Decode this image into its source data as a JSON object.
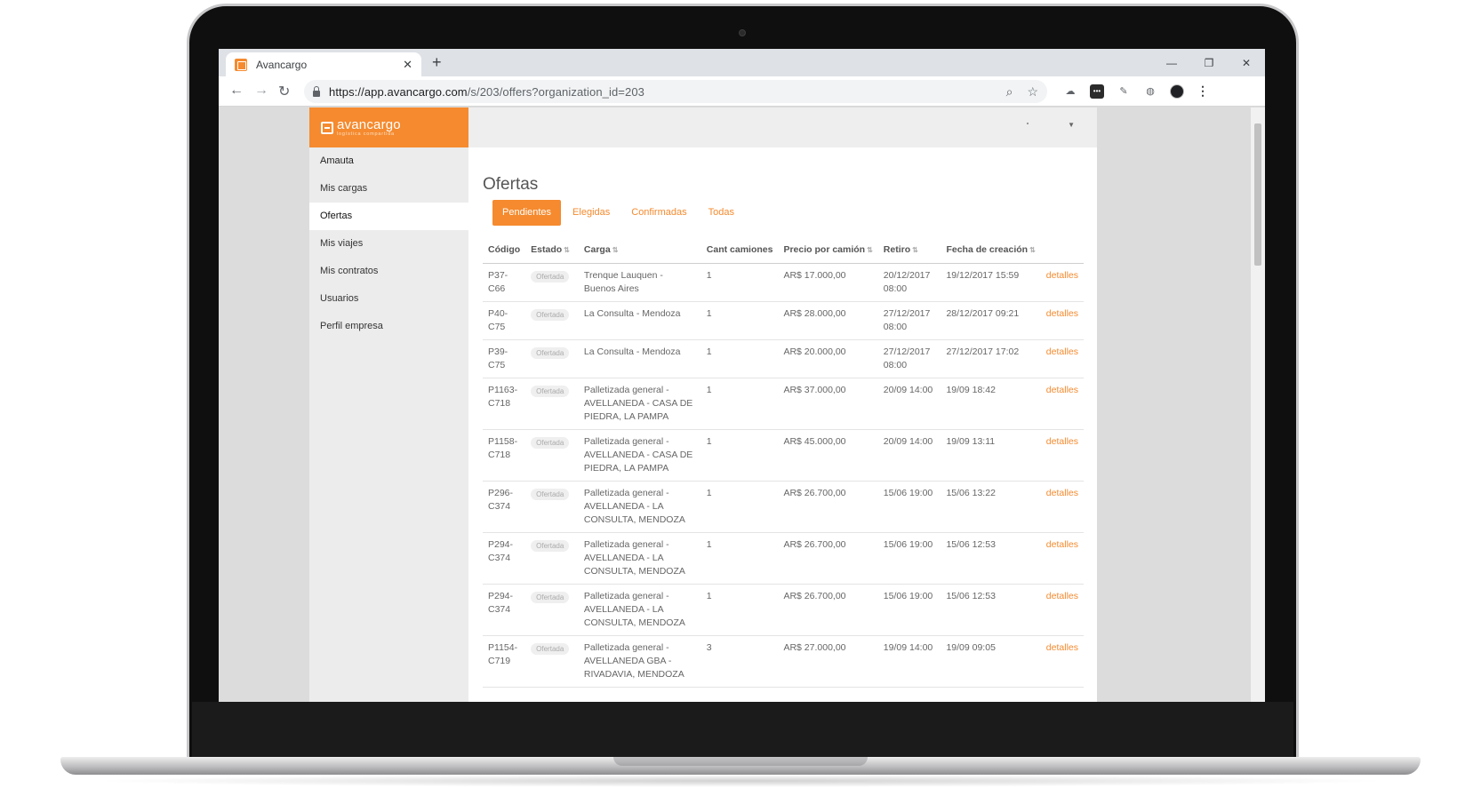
{
  "browser": {
    "tab_title": "Avancargo",
    "url_host": "https://app.avancargo.com",
    "url_path": "/s/203/offers?organization_id=203"
  },
  "app": {
    "logo_name": "avancargo",
    "logo_tagline": "logística compartida"
  },
  "sidebar": {
    "user": "Amauta",
    "items": [
      {
        "label": "Mis cargas"
      },
      {
        "label": "Ofertas"
      },
      {
        "label": "Mis viajes"
      },
      {
        "label": "Mis contratos"
      },
      {
        "label": "Usuarios"
      },
      {
        "label": "Perfil empresa"
      }
    ],
    "active_item": "Ofertas"
  },
  "main": {
    "title": "Ofertas",
    "filter_tabs": [
      {
        "label": "Pendientes"
      },
      {
        "label": "Elegidas"
      },
      {
        "label": "Confirmadas"
      },
      {
        "label": "Todas"
      }
    ],
    "active_tab": "Pendientes"
  },
  "table": {
    "columns": [
      "Código",
      "Estado",
      "Carga",
      "Cant camiones",
      "Precio por camión",
      "Retiro",
      "Fecha de creación"
    ],
    "sortable_columns": [
      "Estado",
      "Carga",
      "Precio por camión",
      "Retiro",
      "Fecha de creación"
    ],
    "action_label": "detalles",
    "rows": [
      {
        "codigo": "P37-C66",
        "estado": "Ofertada",
        "carga": "Trenque Lauquen - Buenos Aires",
        "camiones": "1",
        "precio": "AR$ 17.000,00",
        "retiro": "20/12/2017 08:00",
        "creacion": "19/12/2017 15:59"
      },
      {
        "codigo": "P40-C75",
        "estado": "Ofertada",
        "carga": "La Consulta - Mendoza",
        "camiones": "1",
        "precio": "AR$ 28.000,00",
        "retiro": "27/12/2017 08:00",
        "creacion": "28/12/2017 09:21"
      },
      {
        "codigo": "P39-C75",
        "estado": "Ofertada",
        "carga": "La Consulta - Mendoza",
        "camiones": "1",
        "precio": "AR$ 20.000,00",
        "retiro": "27/12/2017 08:00",
        "creacion": "27/12/2017 17:02"
      },
      {
        "codigo": "P1163-C718",
        "estado": "Ofertada",
        "carga": "Palletizada general - AVELLANEDA - CASA DE PIEDRA, LA PAMPA",
        "camiones": "1",
        "precio": "AR$ 37.000,00",
        "retiro": "20/09 14:00",
        "creacion": "19/09 18:42"
      },
      {
        "codigo": "P1158-C718",
        "estado": "Ofertada",
        "carga": "Palletizada general - AVELLANEDA - CASA DE PIEDRA, LA PAMPA",
        "camiones": "1",
        "precio": "AR$ 45.000,00",
        "retiro": "20/09 14:00",
        "creacion": "19/09 13:11"
      },
      {
        "codigo": "P296-C374",
        "estado": "Ofertada",
        "carga": "Palletizada general - AVELLANEDA - LA CONSULTA, MENDOZA",
        "camiones": "1",
        "precio": "AR$ 26.700,00",
        "retiro": "15/06 19:00",
        "creacion": "15/06 13:22"
      },
      {
        "codigo": "P294-C374",
        "estado": "Ofertada",
        "carga": "Palletizada general - AVELLANEDA - LA CONSULTA, MENDOZA",
        "camiones": "1",
        "precio": "AR$ 26.700,00",
        "retiro": "15/06 19:00",
        "creacion": "15/06 12:53"
      },
      {
        "codigo": "P294-C374",
        "estado": "Ofertada",
        "carga": "Palletizada general - AVELLANEDA - LA CONSULTA, MENDOZA",
        "camiones": "1",
        "precio": "AR$ 26.700,00",
        "retiro": "15/06 19:00",
        "creacion": "15/06 12:53"
      },
      {
        "codigo": "P1154-C719",
        "estado": "Ofertada",
        "carga": "Palletizada general - AVELLANEDA GBA - RIVADAVIA, MENDOZA",
        "camiones": "3",
        "precio": "AR$ 27.000,00",
        "retiro": "19/09 14:00",
        "creacion": "19/09 09:05"
      }
    ]
  },
  "colors": {
    "accent": "#f58a2e",
    "sidebar_bg": "#ececec",
    "topbar_bg": "#eeeeee"
  },
  "icons": {
    "tab": "avancargo-favicon",
    "close": "close-icon",
    "new_tab": "plus-icon",
    "back": "arrow-left-icon",
    "forward": "arrow-right-icon",
    "reload": "reload-icon",
    "lock": "lock-icon",
    "zoom": "magnifier-icon",
    "bookmark": "star-icon",
    "menu": "more-vertical-icon"
  }
}
